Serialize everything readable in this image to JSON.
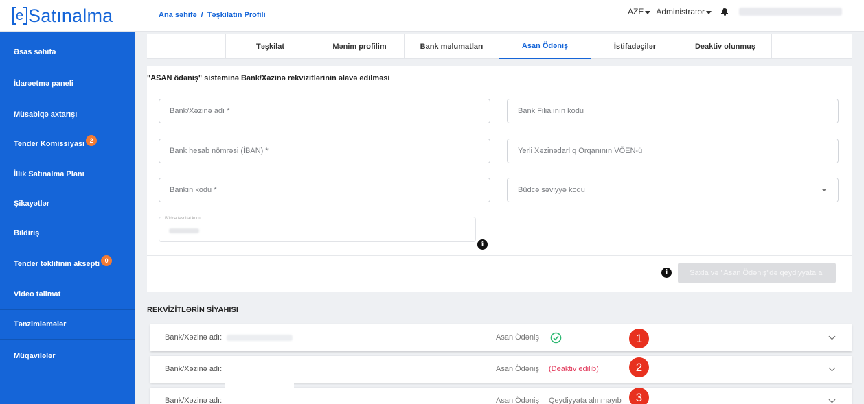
{
  "header": {
    "logo_text": "Satınalma",
    "logo_mark": "e",
    "breadcrumb": [
      "Ana səhifə",
      "Təşkilatın Profili"
    ],
    "breadcrumb_sep": "/",
    "language": "AZE",
    "user_role": "Administrator"
  },
  "sidebar": {
    "items": [
      {
        "label": "Əsas səhifə",
        "badge": ""
      },
      {
        "label": "İdarəetmə paneli",
        "badge": ""
      },
      {
        "label": "Müsabiqə axtarışı",
        "badge": ""
      },
      {
        "label": "Tender Komissiyası",
        "badge": "2"
      },
      {
        "label": "İllik Satınalma Planı",
        "badge": ""
      },
      {
        "label": "Şikayətlər",
        "badge": ""
      },
      {
        "label": "Bildiriş",
        "badge": ""
      },
      {
        "label": "Tender təklifinin aksepti",
        "badge": "0"
      },
      {
        "label": "Video təlimat",
        "badge": ""
      },
      {
        "label": "Tənzimləmələr",
        "badge": ""
      },
      {
        "label": "Müqavilələr",
        "badge": ""
      }
    ]
  },
  "tabs": [
    {
      "label": "Təşkilat",
      "active": false
    },
    {
      "label": "Mənim profilim",
      "active": false
    },
    {
      "label": "Bank məlumatları",
      "active": false
    },
    {
      "label": "Asan Ödəniş",
      "active": true
    },
    {
      "label": "İstifadəçilər",
      "active": false
    },
    {
      "label": "Deaktiv olunmuş",
      "active": false
    }
  ],
  "form": {
    "title": "\"ASAN ödəniş\" sisteminə Bank/Xəzinə rekvizitlərinin əlavə edilməsi",
    "fields": {
      "bank_name": "Bank/Xəzinə adı *",
      "branch_code": "Bank Filialının kodu",
      "iban": "Bank hesab nömrəsi (İBAN) *",
      "treasury_voen": "Yerli Xəzinədarlıq Orqanının VÖEN-ü",
      "bank_code": "Bankın kodu *",
      "budget_level": "Büdcə səviyyə kodu",
      "budget_class_label": "Büdcə təsnifat kodu"
    },
    "save_button": "Saxla və \"Asan Ödəniş\"də qeydiyyata al",
    "info_glyph": "i"
  },
  "list": {
    "title": "REKVİZİTLƏRİN SİYAHISI",
    "rows": [
      {
        "label": "Bank/Xəzinə adı:",
        "asan_label": "Asan Ödəniş",
        "status": "",
        "marker": "1"
      },
      {
        "label": "Bank/Xəzinə adı:",
        "asan_label": "Asan Ödəniş",
        "status": "(Deaktiv edilib)",
        "marker": "2"
      },
      {
        "label": "Bank/Xəzinə adı:",
        "asan_label": "Asan Ödəniş",
        "status": "Qeydiyyata alınmayıb",
        "marker": "3"
      }
    ]
  },
  "colors": {
    "primary": "#1565d8",
    "badge": "#f47b33",
    "success": "#2eb872",
    "danger": "#e23b5c",
    "marker": "#e8311f"
  }
}
